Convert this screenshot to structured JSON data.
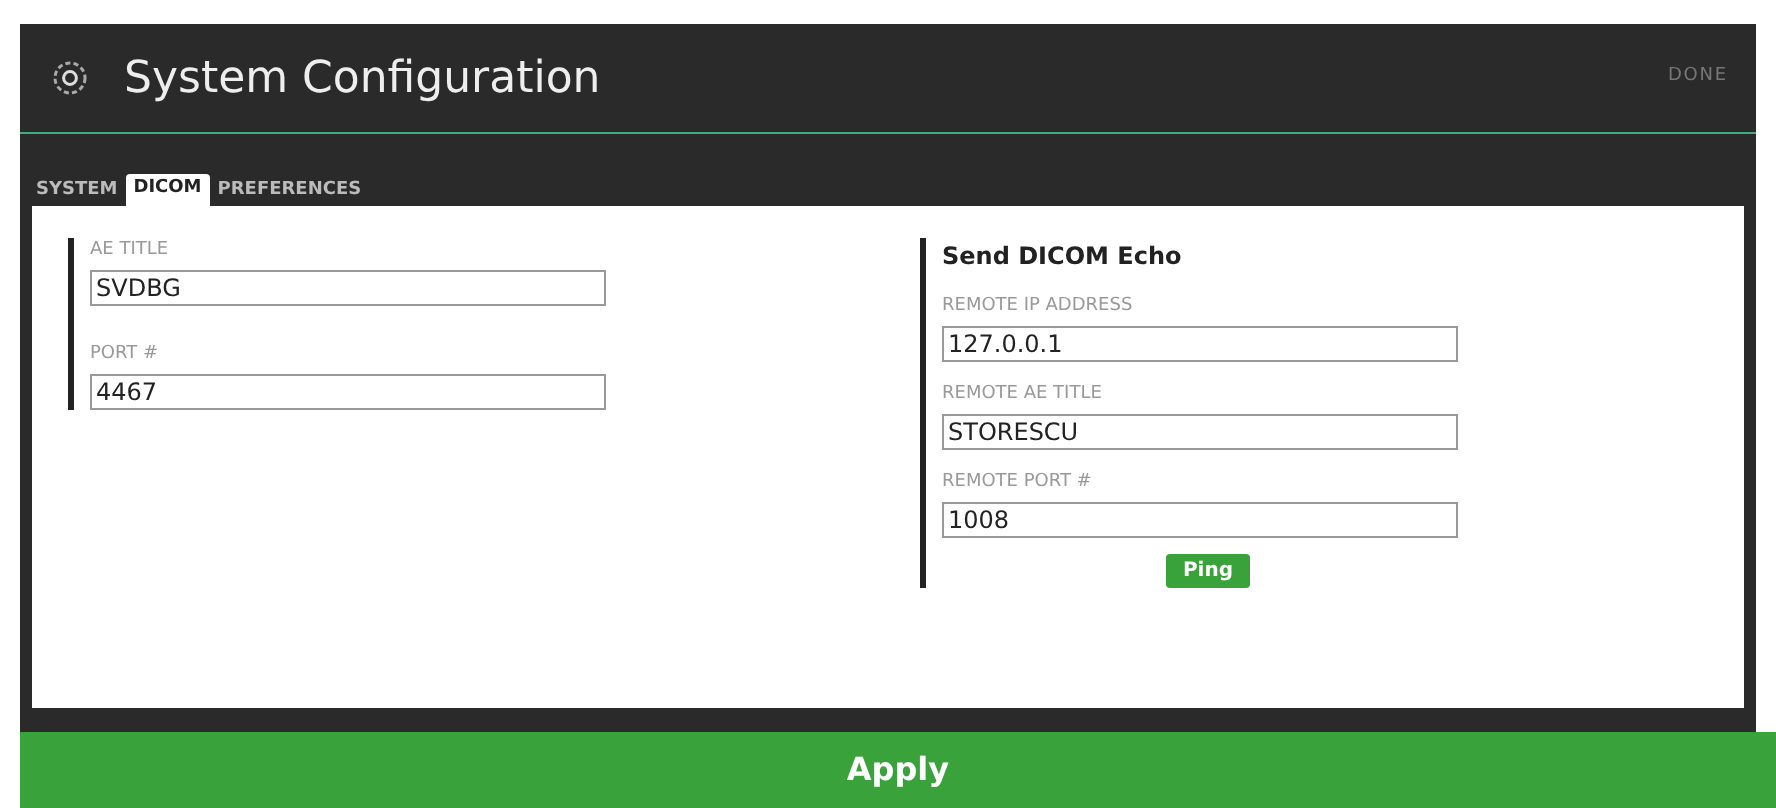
{
  "window": {
    "title": "System Configuration",
    "done": "DONE"
  },
  "tabs": [
    {
      "label": "SYSTEM",
      "selected": false
    },
    {
      "label": "DICOM",
      "selected": true
    },
    {
      "label": "PREFERENCES",
      "selected": false
    }
  ],
  "local": {
    "fields": [
      {
        "label": "AE TITLE",
        "value": "SVDBG"
      },
      {
        "label": "PORT #",
        "value": "4467"
      }
    ]
  },
  "echo": {
    "heading": "Send DICOM Echo",
    "fields": [
      {
        "label": "REMOTE IP ADDRESS",
        "value": "127.0.0.1"
      },
      {
        "label": "REMOTE AE TITLE",
        "value": "STORESCU"
      },
      {
        "label": "REMOTE PORT #",
        "value": "1008"
      }
    ],
    "ping": "Ping"
  },
  "apply": "Apply"
}
